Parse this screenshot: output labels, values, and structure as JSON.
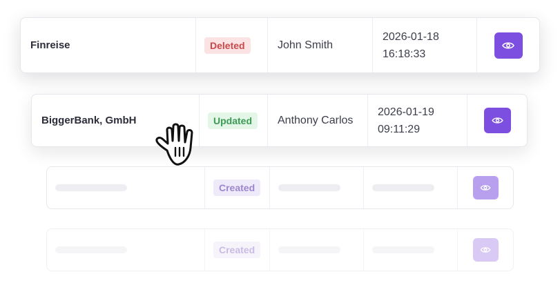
{
  "rows": [
    {
      "company": "Finreise",
      "status": "Deleted",
      "person": "John Smith",
      "date": "2026-01-18",
      "time": "16:18:33",
      "status_color": "#c8484b"
    },
    {
      "company": "BiggerBank, GmbH",
      "status": "Updated",
      "person": "Anthony Carlos",
      "date": "2026-01-19",
      "time": "09:11:29",
      "status_color": "#3c9a55"
    },
    {
      "status": "Created",
      "placeholder": true
    },
    {
      "status": "Created",
      "placeholder": true
    }
  ],
  "icons": {
    "view": "eye-icon",
    "cursor": "grab-hand-cursor-icon"
  },
  "colors": {
    "accent": "#7c4fe0",
    "accent_faded": "#b9a0ee",
    "accent_faint": "#d8caf6"
  }
}
